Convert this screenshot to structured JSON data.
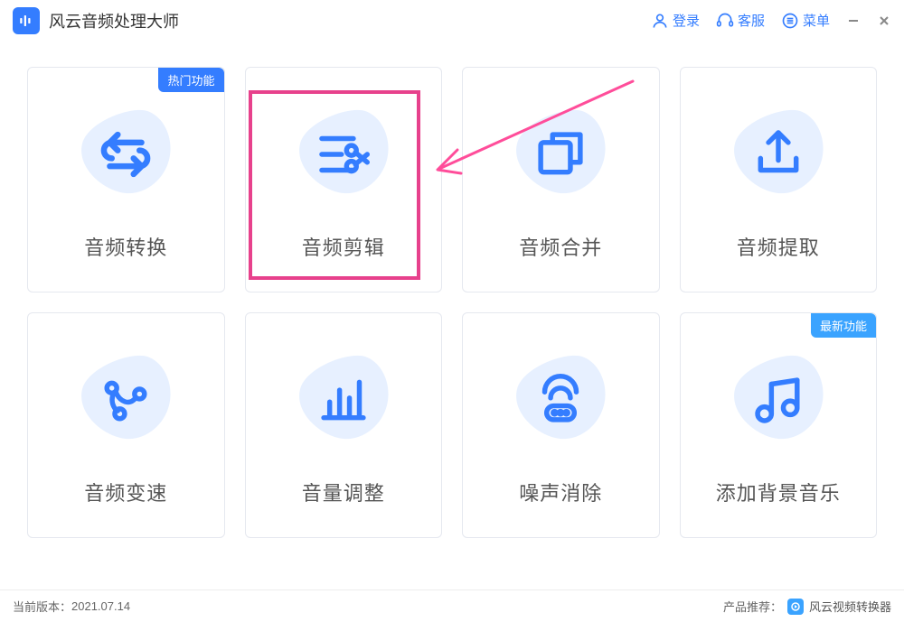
{
  "app": {
    "title": "风云音频处理大师"
  },
  "titlebar": {
    "login": "登录",
    "service": "客服",
    "menu": "菜单"
  },
  "badges": {
    "hot": "热门功能",
    "new": "最新功能"
  },
  "cards": [
    {
      "id": "convert",
      "label": "音频转换",
      "badge": "hot"
    },
    {
      "id": "edit",
      "label": "音频剪辑"
    },
    {
      "id": "merge",
      "label": "音频合并"
    },
    {
      "id": "extract",
      "label": "音频提取"
    },
    {
      "id": "speed",
      "label": "音频变速"
    },
    {
      "id": "volume",
      "label": "音量调整"
    },
    {
      "id": "denoise",
      "label": "噪声消除"
    },
    {
      "id": "bgm",
      "label": "添加背景音乐",
      "badge": "new"
    }
  ],
  "footer": {
    "version_label": "当前版本：",
    "version": "2021.07.14",
    "promo_label": "产品推荐：",
    "promo_product": "风云视频转换器"
  },
  "annotation": {
    "target_card": "edit"
  }
}
